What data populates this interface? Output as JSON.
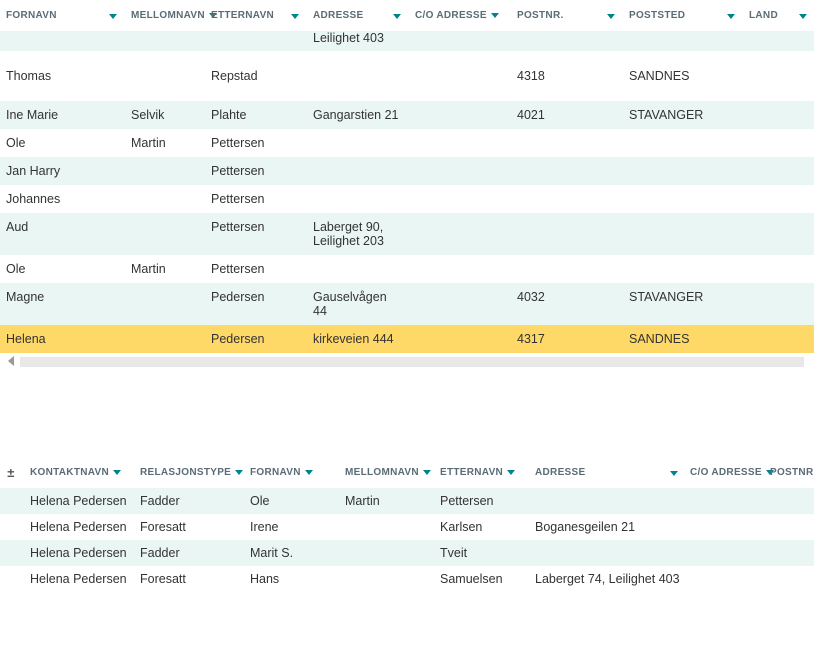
{
  "main": {
    "columns": {
      "fornavn": "Fornavn",
      "mellomnavn": "Mellomnavn",
      "etternavn": "Etternavn",
      "adresse": "Adresse",
      "coadresse": "C/O Adresse",
      "postnr": "Postnr.",
      "poststed": "Poststed",
      "land": "Land"
    },
    "rows": [
      {
        "fornavn": "",
        "mellomnavn": "",
        "etternavn": "",
        "adresse": "Leilighet 403",
        "coadresse": "",
        "postnr": "",
        "poststed": "",
        "land": "",
        "style": "alt partial-top-row"
      },
      {
        "fornavn": "Thomas",
        "mellomnavn": "",
        "etternavn": "Repstad",
        "adresse": "",
        "coadresse": "",
        "postnr": "4318",
        "poststed": "SANDNES",
        "land": "",
        "style": "plain tall"
      },
      {
        "fornavn": "Ine Marie",
        "mellomnavn": "Selvik",
        "etternavn": "Plahte",
        "adresse": "Gangarstien 21",
        "coadresse": "",
        "postnr": "4021",
        "poststed": "STAVANGER",
        "land": "",
        "style": "alt"
      },
      {
        "fornavn": "Ole",
        "mellomnavn": "Martin",
        "etternavn": "Pettersen",
        "adresse": "",
        "coadresse": "",
        "postnr": "",
        "poststed": "",
        "land": "",
        "style": "plain"
      },
      {
        "fornavn": "Jan Harry",
        "mellomnavn": "",
        "etternavn": "Pettersen",
        "adresse": "",
        "coadresse": "",
        "postnr": "",
        "poststed": "",
        "land": "",
        "style": "alt"
      },
      {
        "fornavn": "Johannes",
        "mellomnavn": "",
        "etternavn": "Pettersen",
        "adresse": "",
        "coadresse": "",
        "postnr": "",
        "poststed": "",
        "land": "",
        "style": "plain"
      },
      {
        "fornavn": "Aud",
        "mellomnavn": "",
        "etternavn": "Pettersen",
        "adresse": "Laberget 90, Leilighet 203",
        "coadresse": "",
        "postnr": "",
        "poststed": "",
        "land": "",
        "style": "alt"
      },
      {
        "fornavn": "Ole",
        "mellomnavn": "Martin",
        "etternavn": "Pettersen",
        "adresse": "",
        "coadresse": "",
        "postnr": "",
        "poststed": "",
        "land": "",
        "style": "plain"
      },
      {
        "fornavn": "Magne",
        "mellomnavn": "",
        "etternavn": "Pedersen",
        "adresse": "Gauselvågen 44",
        "coadresse": "",
        "postnr": "4032",
        "poststed": "STAVANGER",
        "land": "",
        "style": "alt"
      },
      {
        "fornavn": "Helena",
        "mellomnavn": "",
        "etternavn": "Pedersen",
        "adresse": "kirkeveien 444",
        "coadresse": "",
        "postnr": "4317",
        "poststed": "SANDNES",
        "land": "",
        "style": "highlight"
      }
    ]
  },
  "secondary": {
    "columns": {
      "expand": "±",
      "kontaktnavn": "Kontaktnavn",
      "relasjonstype": "Relasjonstype",
      "fornavn": "Fornavn",
      "mellomnavn": "Mellomnavn",
      "etternavn": "Etternavn",
      "adresse": "Adresse",
      "coadresse": "C/O Adresse",
      "postnr": "Postnr."
    },
    "rows": [
      {
        "kontaktnavn": "Helena  Pedersen",
        "relasjonstype": "Fadder",
        "fornavn": "Ole",
        "mellomnavn": "Martin",
        "etternavn": "Pettersen",
        "adresse": "",
        "coadresse": "",
        "postnr": "",
        "style": "alt"
      },
      {
        "kontaktnavn": "Helena  Pedersen",
        "relasjonstype": "Foresatt",
        "fornavn": "Irene",
        "mellomnavn": "",
        "etternavn": "Karlsen",
        "adresse": "Boganesgeilen 21",
        "coadresse": "",
        "postnr": "",
        "style": "plain"
      },
      {
        "kontaktnavn": "Helena  Pedersen",
        "relasjonstype": "Fadder",
        "fornavn": "Marit S.",
        "mellomnavn": "",
        "etternavn": "Tveit",
        "adresse": "",
        "coadresse": "",
        "postnr": "",
        "style": "alt"
      },
      {
        "kontaktnavn": "Helena  Pedersen",
        "relasjonstype": "Foresatt",
        "fornavn": "Hans",
        "mellomnavn": "",
        "etternavn": "Samuelsen",
        "adresse": "Laberget 74, Leilighet 403",
        "coadresse": "",
        "postnr": "",
        "style": "plain"
      }
    ]
  }
}
